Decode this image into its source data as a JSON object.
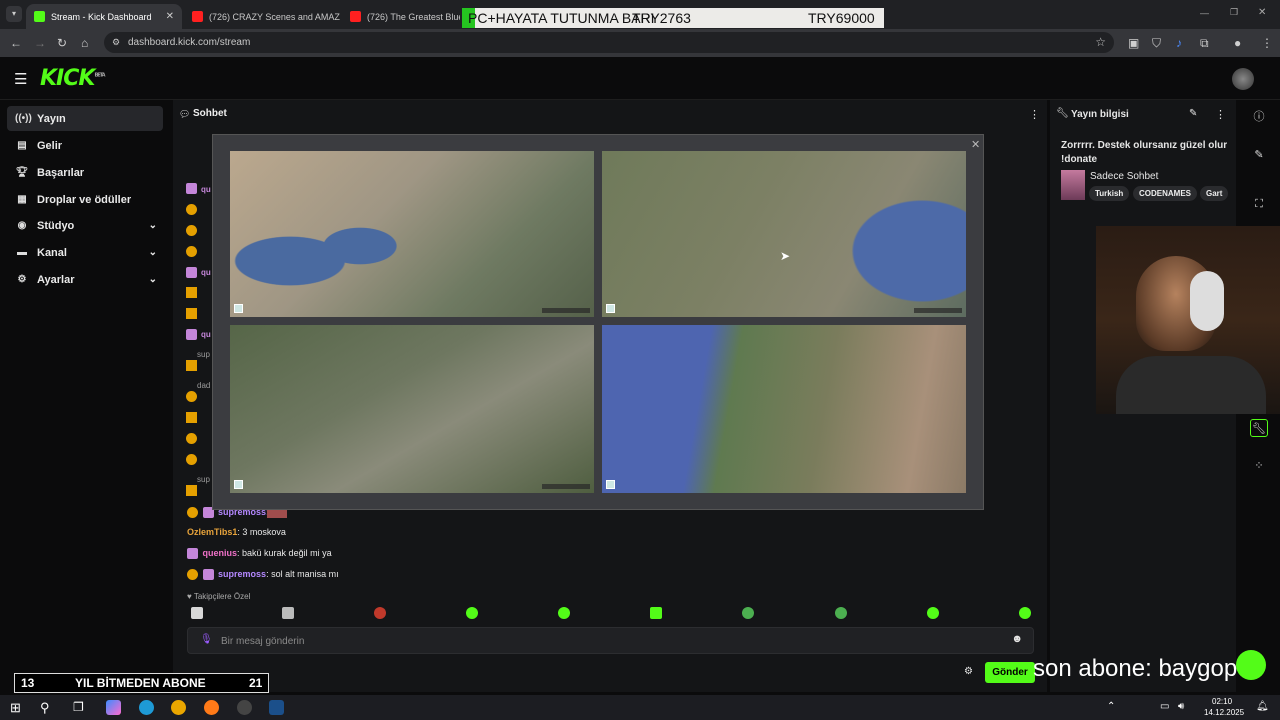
{
  "browser": {
    "tabs": [
      {
        "title": "Stream - Kick Dashboard",
        "active": true
      },
      {
        "title": "(726) CRAZY Scenes and AMAZ",
        "active": false
      },
      {
        "title": "(726) The Greatest Blues Ba",
        "active": false
      }
    ],
    "url": "dashboard.kick.com/stream"
  },
  "overlay_top": {
    "left": "PC+HAYATA TUTUNMA BARI",
    "middle": "TRY2763",
    "right": "TRY69000"
  },
  "kick": {
    "logo": "KICK",
    "logo_badge": "BETA"
  },
  "sidebar": {
    "items": [
      {
        "label": "Yayın",
        "icon": "broadcast-icon",
        "active": true
      },
      {
        "label": "Gelir",
        "icon": "revenue-icon"
      },
      {
        "label": "Başarılar",
        "icon": "trophy-icon"
      },
      {
        "label": "Droplar ve ödüller",
        "icon": "gift-icon"
      },
      {
        "label": "Stüdyo",
        "icon": "studio-icon",
        "expand": true
      },
      {
        "label": "Kanal",
        "icon": "channel-icon",
        "expand": true
      },
      {
        "label": "Ayarlar",
        "icon": "settings-icon",
        "expand": true
      }
    ]
  },
  "chat": {
    "title": "Sohbet",
    "stubs": [
      "qu",
      "qu",
      "qu",
      "sup",
      "dad",
      "sup",
      "supremoss:"
    ],
    "messages": [
      {
        "user": "OzlemTibs1",
        "text": ": 3 moskova",
        "color": "#e7a33b"
      },
      {
        "user": "quenius",
        "text": ": bakü kurak değil mi ya",
        "color": "#f071c8"
      },
      {
        "user": "supremoss",
        "text": ": sol alt manisa mı",
        "color": "#b488ff"
      }
    ],
    "followers_only": "Takipçilere Özel",
    "input_placeholder": "Bir mesaj gönderin",
    "send_label": "Gönder"
  },
  "stream_info": {
    "header": "Yayın bilgisi",
    "title": "Zorrrrr. Destek olursanız güzel olur !donate",
    "category": "Sadece Sohbet",
    "tags": [
      "Turkish",
      "CODENAMES",
      "Gart"
    ]
  },
  "bottom_overlay": {
    "left_num": "13",
    "text": "YIL BİTMEDEN ABONE",
    "right_num": "21"
  },
  "sub_ticker": "son abone: baygopo",
  "clock": {
    "time": "02:10",
    "date": "14.12.2025"
  }
}
